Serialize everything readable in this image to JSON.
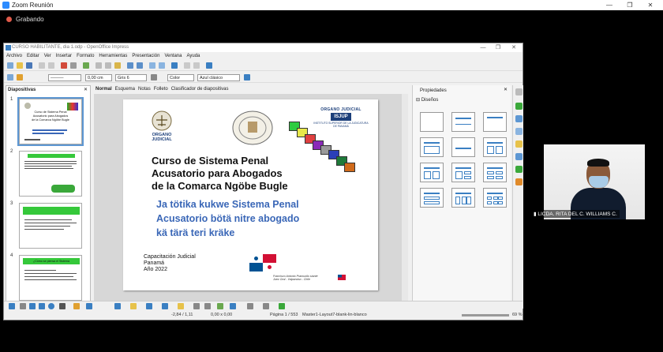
{
  "zoom": {
    "title": "Zoom Reunión",
    "recording_label": "Grabando",
    "participant_name": "LICDA. RITA DEL C. WILLIAMS C.",
    "recording_color": "#e05a4a"
  },
  "impress": {
    "window_title": "CURSO HABILITANTE, dia 1.odp - OpenOffice Impress",
    "menu": [
      "Archivo",
      "Editar",
      "Ver",
      "Insertar",
      "Formato",
      "Herramientas",
      "Presentación",
      "Ventana",
      "Ayuda"
    ],
    "toolbar2": {
      "line_width": "0,00 cm",
      "fill_style": "Gris 6",
      "color_mode": "Color",
      "area_color": "Azul clásico"
    },
    "slides_pane_title": "Diapositivas",
    "view_tabs": [
      "Normal",
      "Esquema",
      "Notas",
      "Folleto",
      "Clasificador de diapositivas"
    ],
    "active_tab": "Normal",
    "properties_title": "Propiedades",
    "layouts_section": "Diseños",
    "status": {
      "position": "-2,84 / 1,11",
      "size": "0,00 x 0,00",
      "page": "Página 1 / 553",
      "master": "Master1-Layout7-blank-lin-blanco",
      "zoom": "69 %"
    }
  },
  "slide": {
    "logo_left": "ORGANO JUDICIAL",
    "logo_right_top": "ORGANO JUDICIAL",
    "logo_right_tag": "ISJUP",
    "logo_right_sub": "INSTITUTO SUPERIOR DE LA JUDICATURA DE PANAMÁ",
    "title_es_1": "Curso  de Sistema Penal",
    "title_es_2": "Acusatorio para Abogados",
    "title_es_3": "de la Comarca Ngöbe Bugle",
    "title_ngobe_1": "Ja tötika kukwe Sistema Penal",
    "title_ngobe_2": "Acusatorio bötä nitre abogado",
    "title_ngobe_3": "kä tärä teri kräke",
    "footer_1": "Capacitación Judicial",
    "footer_2": "Panamá",
    "footer_3": "Año 2022",
    "credit_1": "Francisco Antonio Pramuollo stante",
    "credit_2": "Juez Oral - Valparaíso - Chile",
    "title_color": "#111111",
    "ngobe_color": "#3a67b7"
  },
  "thumbnails": [
    {
      "num": "1",
      "lines": [
        "Curso   de Sistema Penal",
        "Acusatorio para Abogados",
        "de la Comarca Ngöbe Bugle"
      ]
    },
    {
      "num": "2",
      "lines": [
        "",
        "",
        ""
      ]
    },
    {
      "num": "3",
      "lines": [
        "",
        "",
        ""
      ]
    },
    {
      "num": "4",
      "lines": [
        "¿Cómo se piensa el Sistema",
        "",
        ""
      ]
    }
  ]
}
